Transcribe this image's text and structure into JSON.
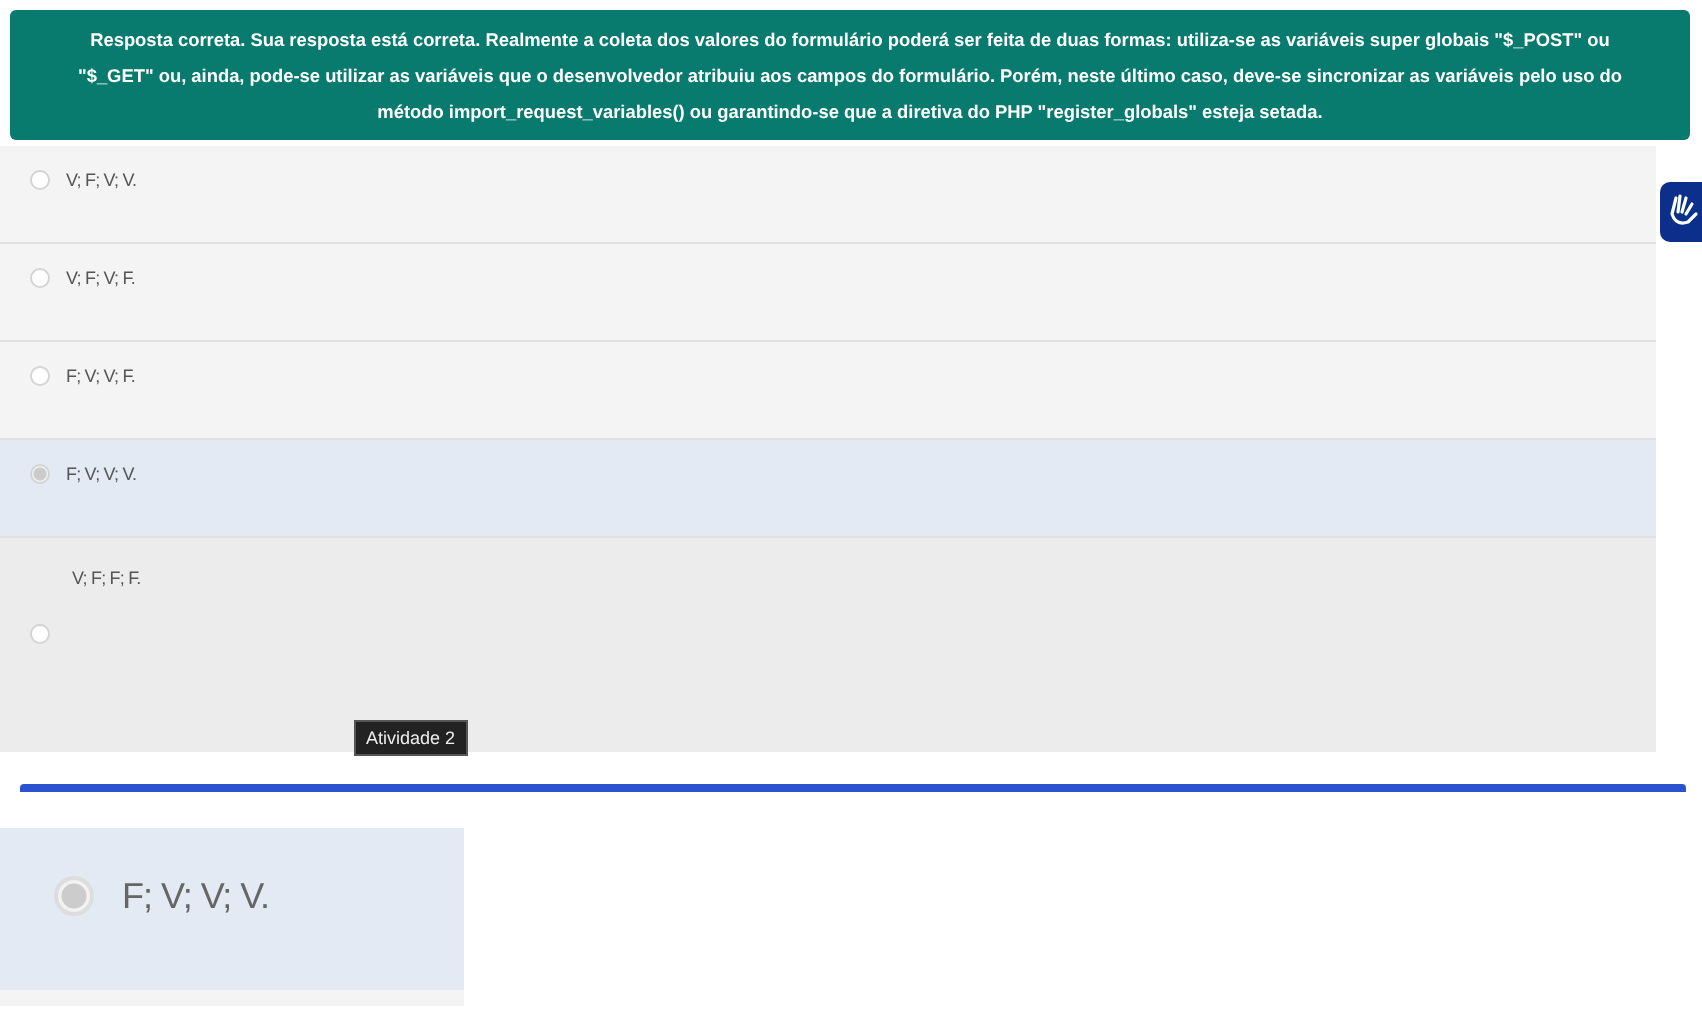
{
  "feedback": {
    "text": "Resposta correta. Sua resposta está correta. Realmente a coleta dos valores do formulário poderá ser feita de duas formas: utiliza-se as variáveis super globais \"$_POST\" ou \"$_GET\" ou, ainda, pode-se utilizar as variáveis que o desenvolvedor atribuiu aos campos do formulário. Porém, neste último caso, deve-se sincronizar as variáveis pelo uso do método import_request_variables() ou garantindo-se que a diretiva do PHP \"register_globals\" esteja setada."
  },
  "options": [
    {
      "label": "V; F; V; V.",
      "selected": false,
      "kind": "inline"
    },
    {
      "label": "V; F; V; F.",
      "selected": false,
      "kind": "inline"
    },
    {
      "label": "F; V; V; F.",
      "selected": false,
      "kind": "inline"
    },
    {
      "label": "F; V; V; V.",
      "selected": true,
      "kind": "inline"
    },
    {
      "label": "V; F; F; F.",
      "selected": false,
      "kind": "stacked"
    }
  ],
  "tooltip": "Atividade 2",
  "zoom_preview": {
    "label": "F; V; V; V.",
    "selected": true
  }
}
